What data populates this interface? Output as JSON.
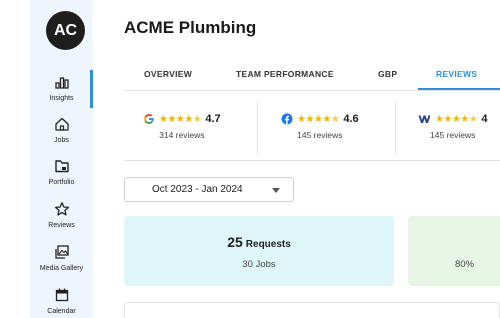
{
  "sidebar": {
    "avatar_initials": "AC",
    "items": [
      {
        "label": "Insights",
        "icon": "bar-chart-icon"
      },
      {
        "label": "Jobs",
        "icon": "home-icon"
      },
      {
        "label": "Portfolio",
        "icon": "folder-icon"
      },
      {
        "label": "Reviews",
        "icon": "star-icon"
      },
      {
        "label": "Media Gallery",
        "icon": "image-gallery-icon"
      },
      {
        "label": "Calendar",
        "icon": "calendar-icon"
      }
    ],
    "active_item": "Insights",
    "accent_color": "#2f8fdb"
  },
  "header": {
    "title": "ACME Plumbing"
  },
  "tabs": [
    {
      "label": "OVERVIEW"
    },
    {
      "label": "TEAM PERFORMANCE"
    },
    {
      "label": "GBP"
    },
    {
      "label": "REVIEWS"
    }
  ],
  "active_tab": "REVIEWS",
  "ratings": [
    {
      "source_icon": "google-icon",
      "stars": 4.7,
      "score": "4.7",
      "count": "314 reviews"
    },
    {
      "source_icon": "facebook-icon",
      "stars": 4.6,
      "score": "4.6",
      "count": "145 reviews"
    },
    {
      "source_icon": "w-logo-icon",
      "stars": 4.5,
      "score": "4",
      "count": "145 reviews"
    }
  ],
  "date_range": {
    "value": "Oct 2023 - Jan 2024"
  },
  "cards": {
    "requests": {
      "number": "25",
      "label": "Requests",
      "sub": "30 Jobs",
      "bg": "#def6f9"
    },
    "second": {
      "number": "",
      "label": "",
      "sub": "80%",
      "bg": "#e7f5e4"
    }
  },
  "bottom_card": {
    "title": ""
  }
}
